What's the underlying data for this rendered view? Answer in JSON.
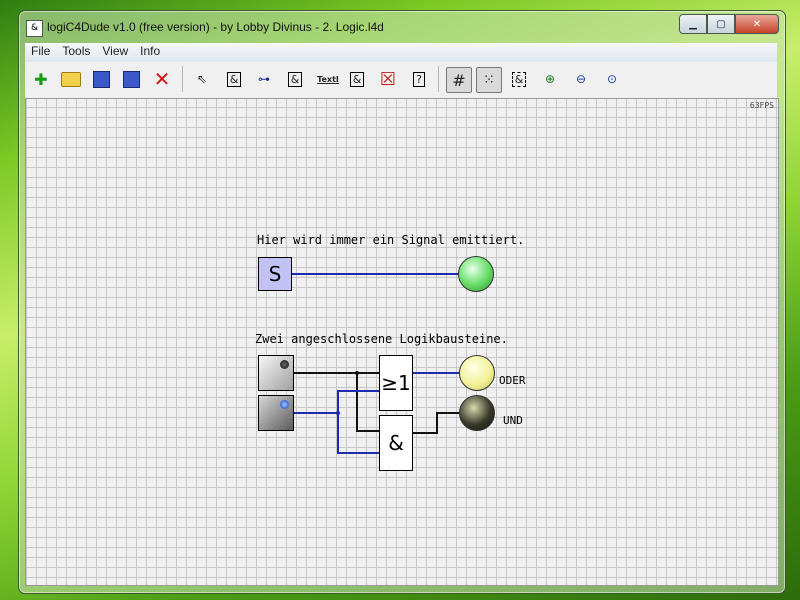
{
  "window": {
    "title": "logiC4Dude v1.0 (free version) - by Lobby Divinus - 2. Logic.l4d"
  },
  "menu": [
    "File",
    "Tools",
    "View",
    "Info"
  ],
  "canvas": {
    "fps": "63FPS",
    "label1": "Hier wird immer ein Signal emittiert.",
    "label2": "Zwei angeschlossene Logikbausteine.",
    "source_symbol": "S",
    "or_gate": "≥1",
    "and_gate": "&",
    "oder_label": "ODER",
    "und_label": "UND"
  },
  "toolbar": {
    "text_tool": "TextI"
  },
  "colors": {
    "wire_active": "#1c2bb0",
    "wire_inactive": "#111111",
    "source_fill": "#c2c2f4"
  }
}
